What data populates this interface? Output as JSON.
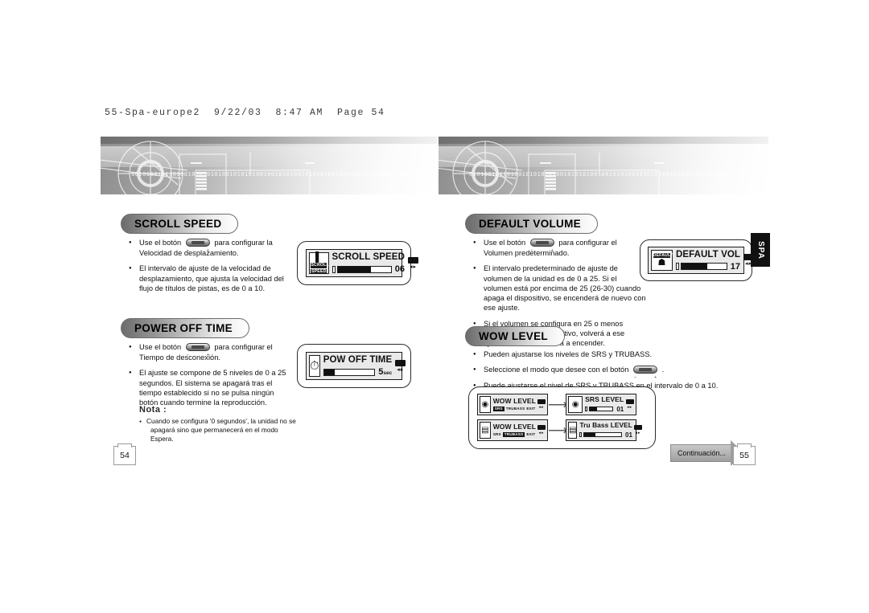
{
  "print_header": "55-Spa-europe2  9/22/03  8:47 AM  Page 54",
  "banner": {
    "binary_left": "1010100101101001010101010010101010010010101001010101001010101010010101011010010101010100101010010101010101010010010101010",
    "binary_right": "0101001011010010101010100101010100100101010010101010010101010100101010110100101010101001010100101010101010100100101010100"
  },
  "side_tab": {
    "label": "SPA"
  },
  "sections": {
    "scroll_speed": {
      "title": "SCROLL SPEED",
      "bullets": [
        {
          "before": "Use el botón",
          "button": true,
          "after": "para configurar la Velocidad de desplazamiento."
        },
        {
          "before": "El intervalo de ajuste de la velocidad de desplazamiento, que ajusta la velocidad del flujo de títulos de pistas, es de 0 a 10.",
          "button": false,
          "after": ""
        }
      ],
      "lcd": {
        "icon_top": "icon-scroll",
        "icon_label_1": "SCROLL",
        "icon_label_2": "SPEED",
        "title": "SCROLL SPEED",
        "value": "06",
        "fill_percent": 62
      }
    },
    "power_off_time": {
      "title": "POWER OFF TIME",
      "bullets": [
        {
          "before": "Use el botón",
          "button": true,
          "after": "para configurar el Tiempo de desconexión."
        },
        {
          "before": "El ajuste se compone de 5 niveles de 0 a 25 segundos. El sistema se apagará tras el tiempo establecido si no se pulsa ningún botón cuando termine la reproducción.",
          "button": false,
          "after": ""
        }
      ],
      "nota_title": "Nota :",
      "nota_line1": "Cuando se configura '0 segundos', la unidad no se",
      "nota_line2": "apagará sino que permanecerá en el modo Espera.",
      "lcd": {
        "icon_glyph": "alarm-clock-icon",
        "title": "POW OFF TIME",
        "value": "5",
        "unit": "sec",
        "fill_percent": 22
      }
    },
    "default_volume": {
      "title": "DEFAULT VOLUME",
      "bullets": [
        {
          "before": "Use el botón",
          "button": true,
          "after": "para configurar el Volumen predeterminado."
        },
        {
          "before": "El intervalo predeterminado de ajuste de volumen de la unidad es de 0 a 25. Si el volumen está por encima de 25 (26-30) cuando apaga el dispositivo, se encenderá de nuevo con ese ajuste.",
          "button": false,
          "after": ""
        },
        {
          "before": "Si el volumen se configura en 25 o menos cuando apaga el dispositivo, volverá a ese ajuste cuando se vuelva a encender.",
          "button": false,
          "after": ""
        }
      ],
      "lcd": {
        "icon_label": "DEFAULT",
        "title": "DEFAULT VOL",
        "value": "17",
        "fill_percent": 58
      }
    },
    "wow_level": {
      "title": "WOW LEVEL",
      "bullets": [
        {
          "before": "Pueden ajustarse los niveles de SRS y TRUBASS.",
          "button": false,
          "after": ""
        },
        {
          "before": "Seleccione el modo que desee con el botón",
          "button": true,
          "after": "."
        },
        {
          "before": "Puede ajustarse el nivel de SRS y TRUBASS en el intervalo de 0 a 10.",
          "button": false,
          "after": ""
        }
      ],
      "panel": {
        "rows": [
          {
            "left": {
              "icon": "srs-wave-icon",
              "title": "WOW LEVEL",
              "tags": [
                {
                  "text": "SRS",
                  "inverted": true
                },
                {
                  "text": "TRUBASS",
                  "inverted": false
                },
                {
                  "text": "EXIT",
                  "inverted": false
                }
              ]
            },
            "arrow": "arrow-right-icon",
            "right": {
              "icon": "srs-wave-icon",
              "title": "SRS LEVEL",
              "value": "01",
              "fill_percent": 30
            }
          },
          {
            "left": {
              "icon": "trubass-icon",
              "title": "WOW LEVEL",
              "tags": [
                {
                  "text": "SRS",
                  "inverted": false
                },
                {
                  "text": "TRUBASS",
                  "inverted": true
                },
                {
                  "text": "EXIT",
                  "inverted": false
                }
              ]
            },
            "arrow": "arrow-right-icon",
            "right": {
              "icon": "trubass-icon",
              "title": "Tru Bass LEVEL",
              "value": "01",
              "fill_percent": 30
            }
          }
        ]
      }
    }
  },
  "footer": {
    "page_left": "54",
    "page_right": "55",
    "continuation": "Continuación..."
  }
}
